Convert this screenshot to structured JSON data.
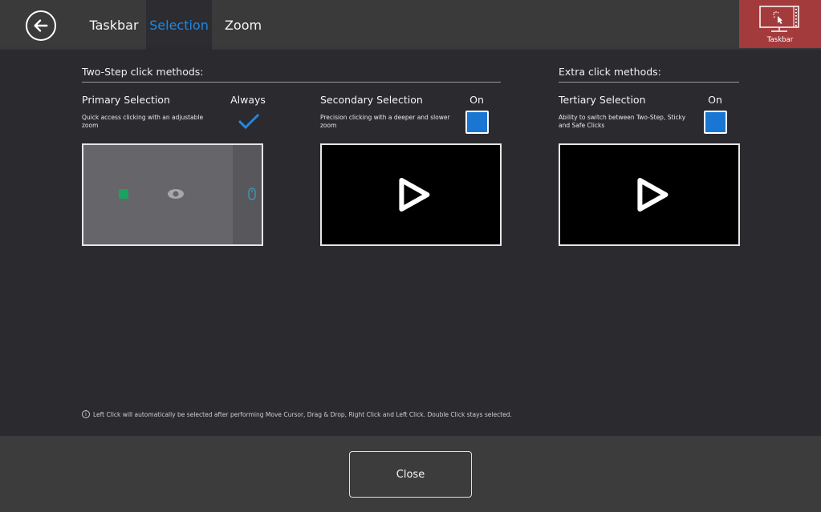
{
  "header": {
    "back_icon": "arrow-left-circle-icon",
    "tabs": [
      {
        "label": "Taskbar",
        "active": false
      },
      {
        "label": "Selection",
        "active": true
      },
      {
        "label": "Zoom",
        "active": false
      }
    ],
    "taskbar_tile": {
      "label": "Taskbar",
      "icon": "monitor-cursor-icon",
      "color": "#a33a3c"
    }
  },
  "groups": {
    "two_step": {
      "title": "Two-Step click methods:"
    },
    "extra": {
      "title": "Extra click methods:"
    }
  },
  "options": [
    {
      "title": "Primary Selection",
      "state": "Always",
      "description": "Quick access clicking with an adjustable zoom",
      "control": "checkmark"
    },
    {
      "title": "Secondary Selection",
      "state": "On",
      "description": "Precision clicking with a deeper and slower zoom",
      "control": "checkbox",
      "checked": true
    },
    {
      "title": "Tertiary Selection",
      "state": "On",
      "description": "Ability to switch between Two-Step, Sticky and Safe Clicks",
      "control": "checkbox",
      "checked": true
    }
  ],
  "info_note": "Left Click will automatically be selected after performing Move Cursor, Drag & Drop, Right Click and Left Click. Double Click stays selected.",
  "footer": {
    "close_label": "Close"
  },
  "colors": {
    "accent": "#1e88e5",
    "checkbox": "#1976d2",
    "taskbar_tile": "#a33a3c"
  }
}
